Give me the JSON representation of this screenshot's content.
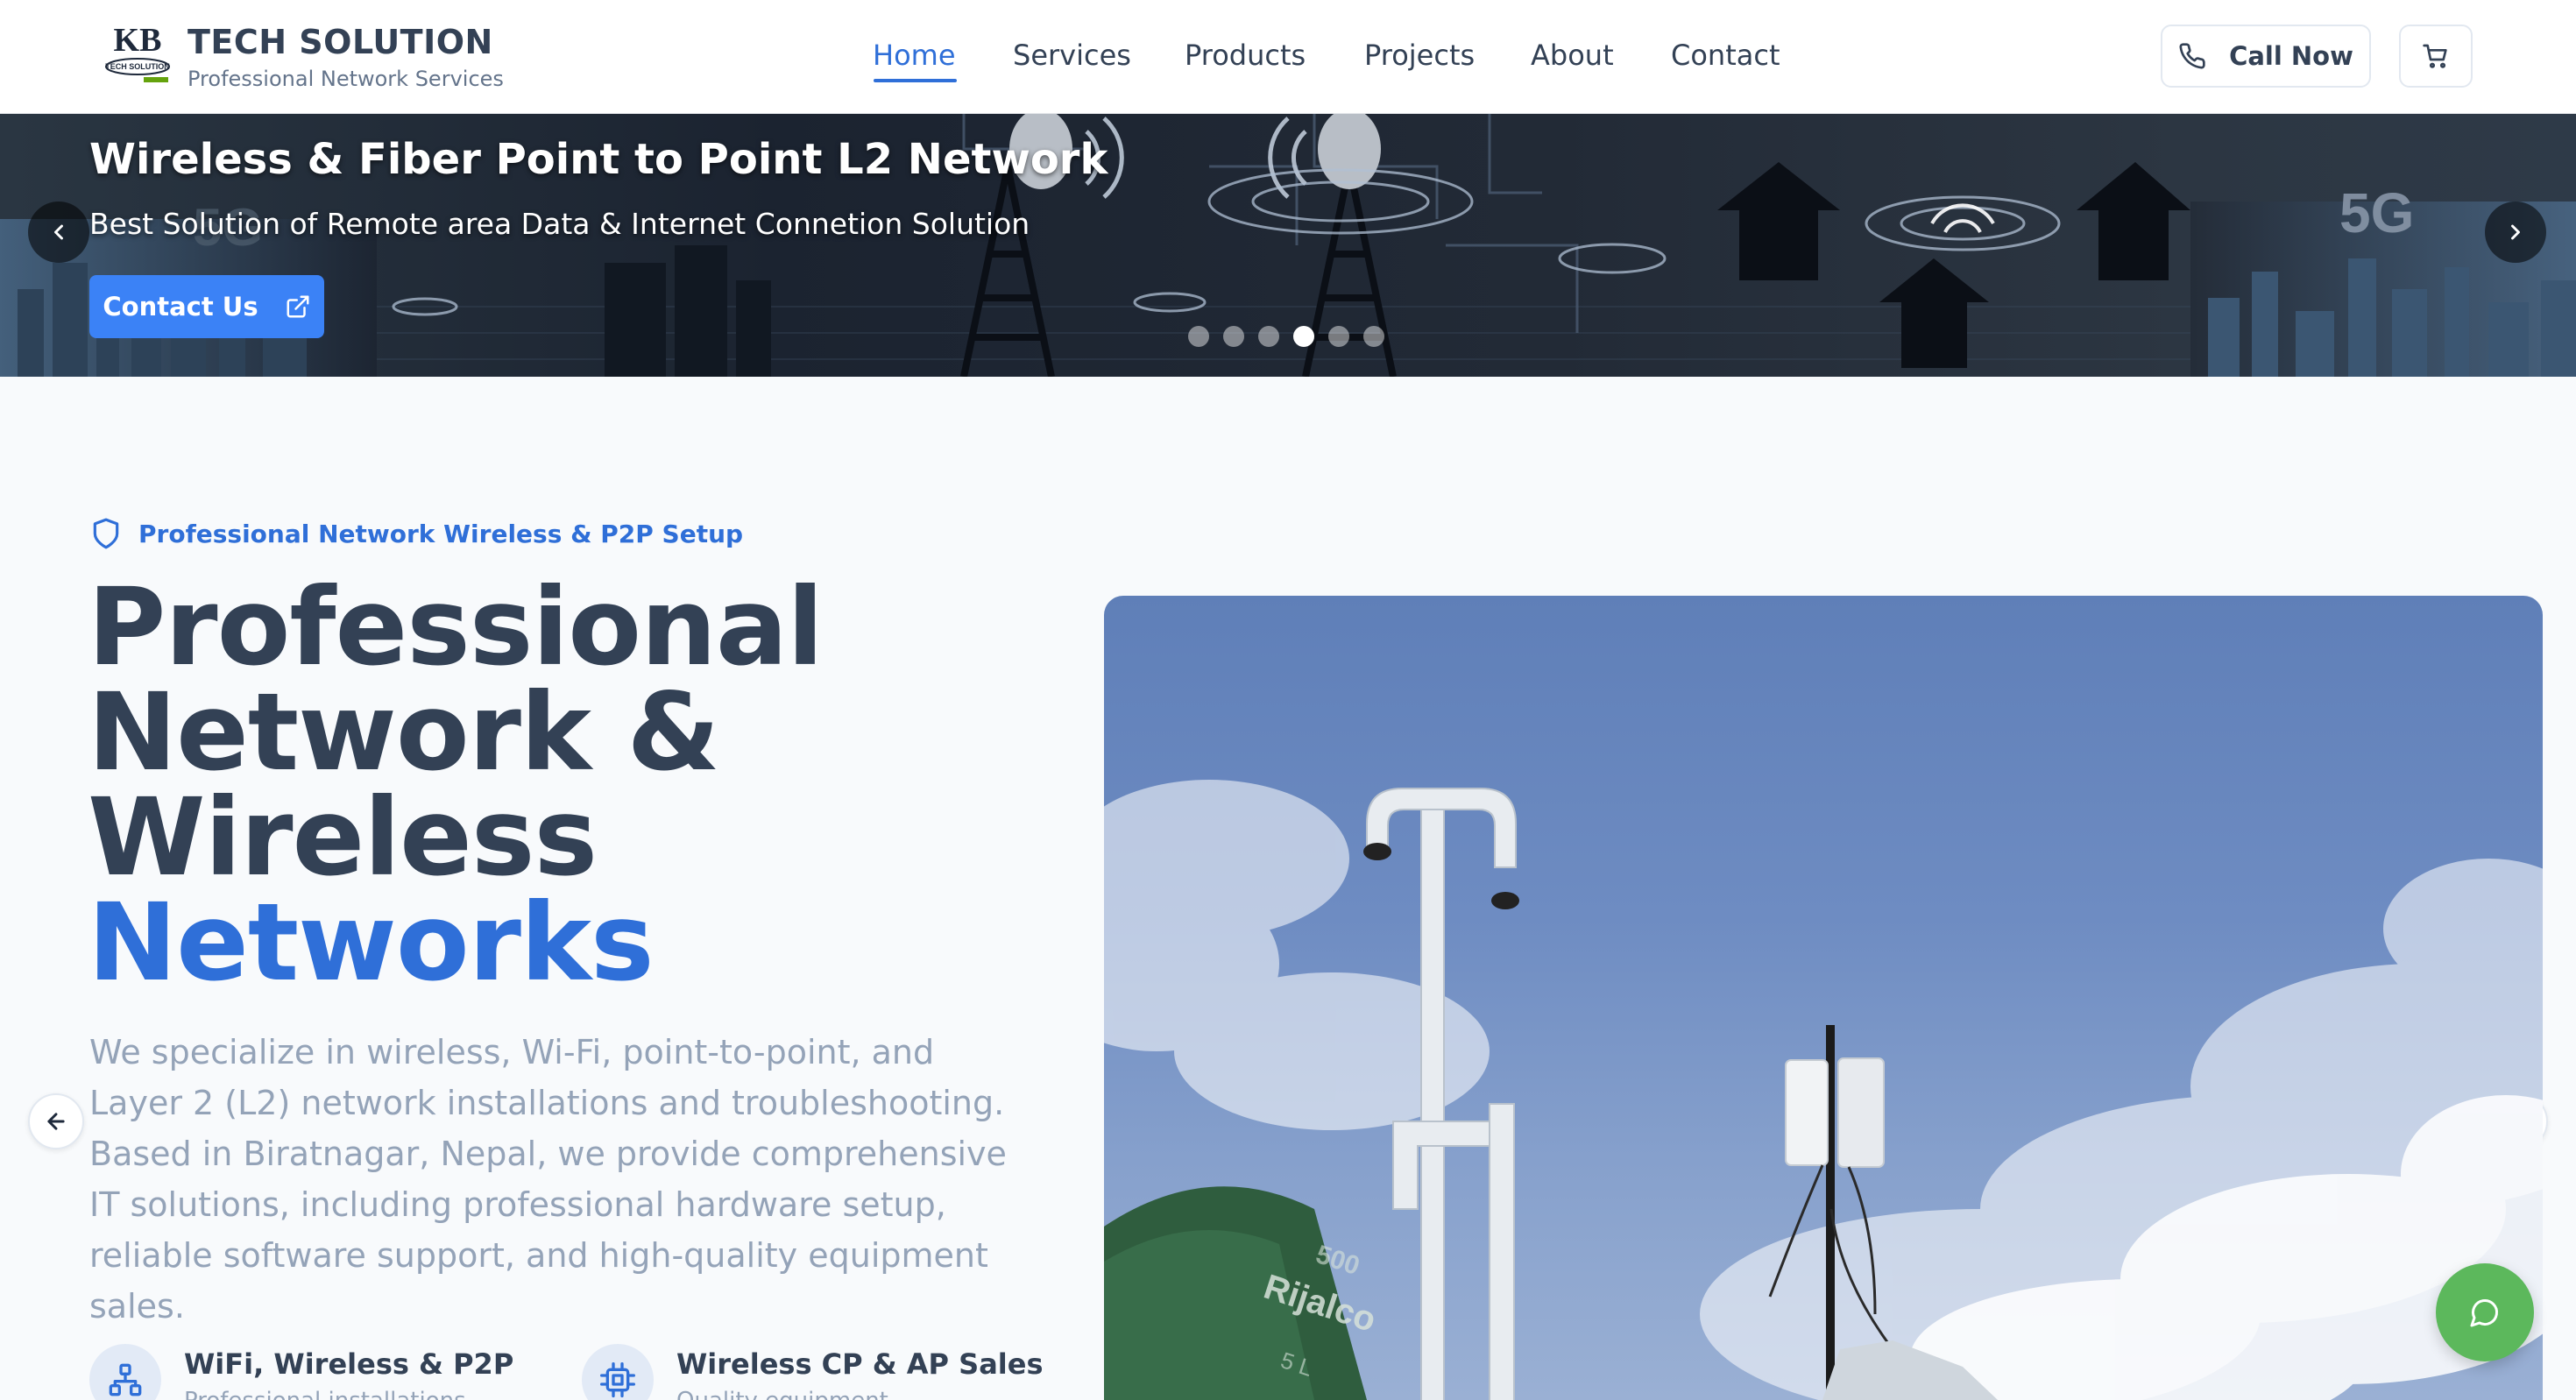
{
  "brand": {
    "logo_text": "KB",
    "logo_subtext": "TECH SOLUTION",
    "title": "TECH SOLUTION",
    "subtitle": "Professional Network Services"
  },
  "nav": {
    "items": [
      {
        "label": "Home",
        "active": true
      },
      {
        "label": "Services",
        "active": false
      },
      {
        "label": "Products",
        "active": false
      },
      {
        "label": "Projects",
        "active": false
      },
      {
        "label": "About",
        "active": false
      },
      {
        "label": "Contact",
        "active": false
      }
    ],
    "call_label": "Call Now"
  },
  "banner": {
    "title": "Wireless & Fiber Point to Point L2 Network",
    "subtitle": "Best Solution of Remote area Data & Internet Connetion Solution",
    "button_label": "Contact Us",
    "art_label_5g": "5G",
    "slide_count": 6,
    "active_slide": 4
  },
  "hero": {
    "tag": "Professional Network Wireless & P2P Setup",
    "title_lines": [
      "Professional",
      "Network &",
      "Wireless"
    ],
    "title_accent": "Networks",
    "description": "We specialize in wireless, Wi-Fi, point-to-point, and Layer 2 (L2) network installations and troubleshooting. Based in Biratnagar, Nepal, we provide comprehensive IT solutions, including professional hardware setup, reliable software support, and high-quality equipment sales.",
    "features": [
      {
        "icon": "network-icon",
        "title": "WiFi, Wireless & P2P",
        "subtitle": "Professional installations"
      },
      {
        "icon": "chip-icon",
        "title": "Wireless CP & AP Sales",
        "subtitle": "Quality equipment"
      }
    ],
    "photo_tank_text": "Rijalco",
    "photo_tank_number": "500",
    "photo_tank_sub": "5 L"
  },
  "colors": {
    "accent": "#2f6fd8",
    "button_blue": "#3b82f6",
    "chat_green": "#5cb85c",
    "heading": "#334155",
    "muted": "#94a3b8"
  }
}
